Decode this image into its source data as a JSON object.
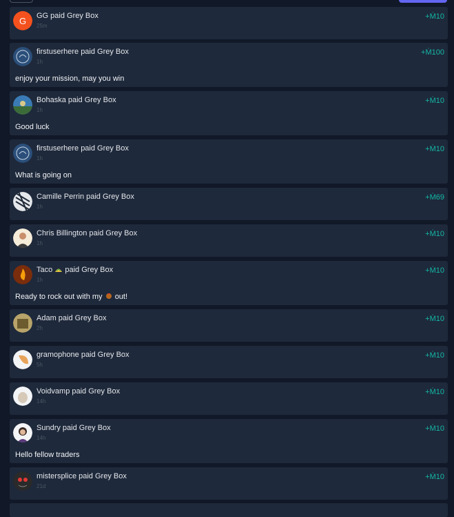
{
  "feed": [
    {
      "title": "GG paid Grey Box",
      "time": "25m",
      "amount": "+Ṁ10",
      "avatar": "letter-g-avatar",
      "avatar_letter": "G",
      "color": "#f4511e"
    },
    {
      "title": "firstuserhere paid Grey Box",
      "time": "1h",
      "amount": "+Ṁ100",
      "comment": "enjoy your mission, may you win",
      "avatar": "logo-avatar",
      "color": "#2b4f7a"
    },
    {
      "title": "Bohaska paid Grey Box",
      "time": "1h",
      "amount": "+Ṁ10",
      "comment": "Good luck",
      "avatar": "landscape-avatar",
      "color": "#3b7bb5"
    },
    {
      "title": "firstuserhere paid Grey Box",
      "time": "1h",
      "amount": "+Ṁ10",
      "comment": "What is going on",
      "avatar": "logo-avatar",
      "color": "#2b4f7a"
    },
    {
      "title": "Camille Perrin paid Grey Box",
      "time": "1h",
      "amount": "+Ṁ69",
      "avatar": "pattern-avatar",
      "color": "#e5e7eb"
    },
    {
      "title": "Chris Billington paid Grey Box",
      "time": "1h",
      "amount": "+Ṁ10",
      "avatar": "person-avatar",
      "color": "#f5ecd9"
    },
    {
      "title": "Taco paid Grey Box",
      "title_before_emoji": "Taco",
      "title_after_emoji": "paid Grey Box",
      "time": "1h",
      "amount": "+Ṁ10",
      "comment": "Ready to rock out with my",
      "comment_after_emoji": "out!",
      "avatar": "fire-avatar",
      "color": "#7a2d0c"
    },
    {
      "title": "Adam paid Grey Box",
      "time": "2h",
      "amount": "+Ṁ10",
      "avatar": "art-avatar",
      "color": "#b8a46a"
    },
    {
      "title": "gramophone paid Grey Box",
      "time": "5h",
      "amount": "+Ṁ10",
      "avatar": "gramophone-avatar",
      "color": "#e7a35a"
    },
    {
      "title": "Voidvamp paid Grey Box",
      "time": "14h",
      "amount": "+Ṁ10",
      "avatar": "creature-avatar",
      "color": "#f3f4f6"
    },
    {
      "title": "Sundry paid Grey Box",
      "time": "14h",
      "amount": "+Ṁ10",
      "comment": "Hello fellow traders",
      "avatar": "person-avatar",
      "color": "#f3f4f6"
    },
    {
      "title": "mistersplice paid Grey Box",
      "time": "21d",
      "amount": "+Ṁ10",
      "avatar": "glasses-avatar",
      "color": "#2a2a2a"
    }
  ]
}
